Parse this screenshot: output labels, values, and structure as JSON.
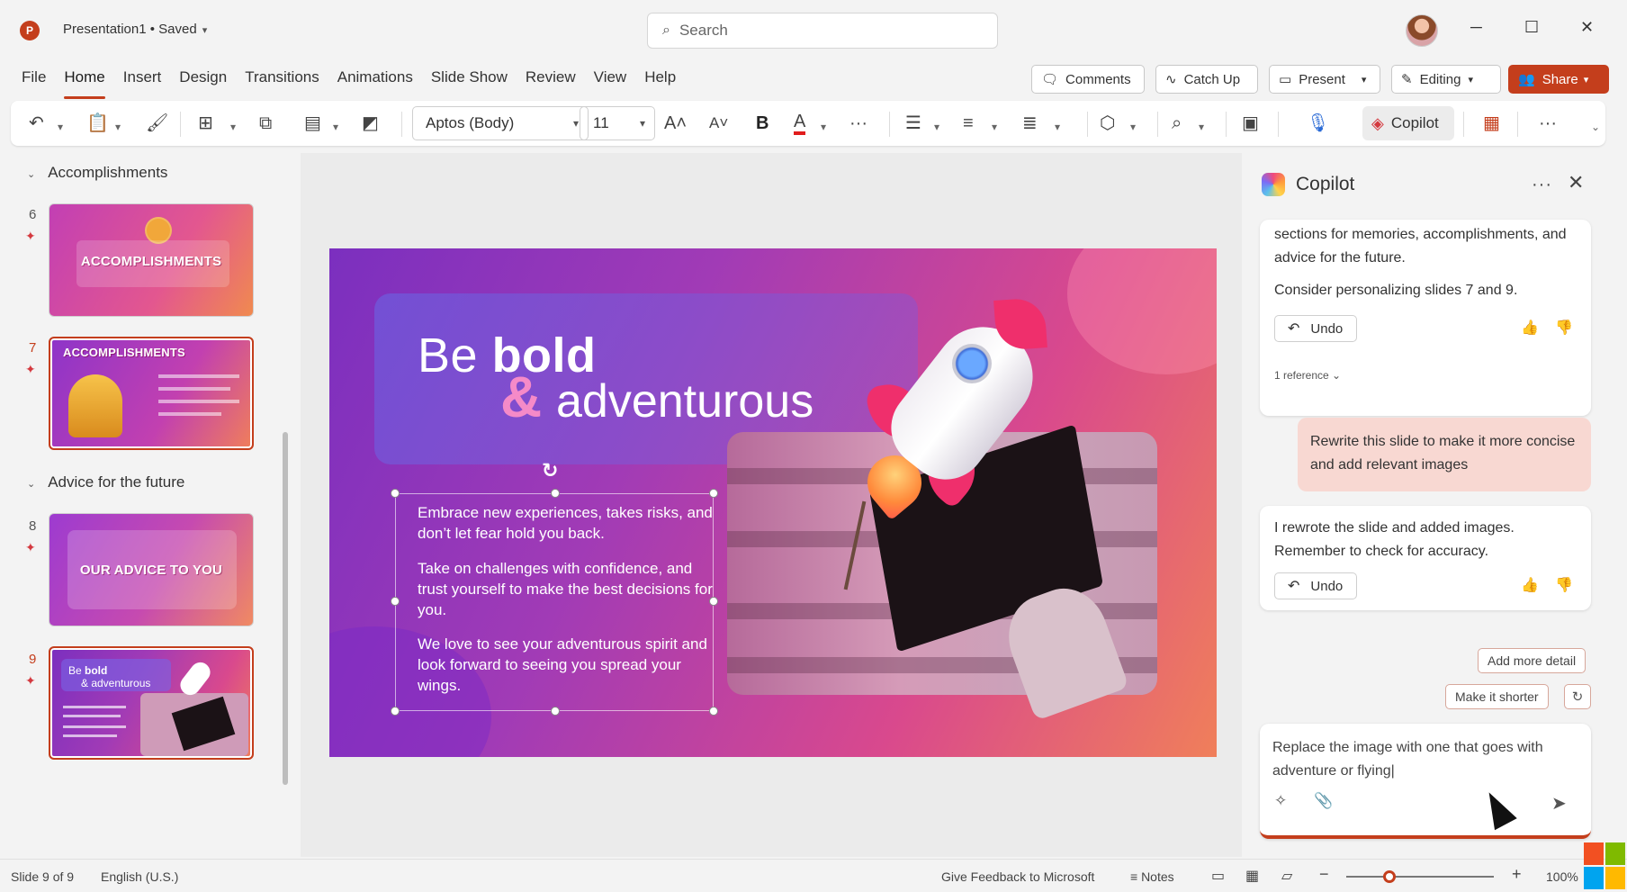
{
  "app": {
    "doc_title": "Presentation1 • Saved",
    "search_placeholder": "Search",
    "window_controls": [
      "─",
      "☐",
      "✕"
    ]
  },
  "ribbon": {
    "tabs": [
      "File",
      "Home",
      "Insert",
      "Design",
      "Transitions",
      "Animations",
      "Slide Show",
      "Review",
      "View",
      "Help"
    ],
    "active_tab": "Home",
    "comments": "Comments",
    "catch_up": "Catch Up",
    "present": "Present",
    "editing": "Editing",
    "share": "Share"
  },
  "toolbar": {
    "font_name": "Aptos (Body)",
    "font_size": "11",
    "bold": "B",
    "copilot": "Copilot"
  },
  "slides_panel": {
    "sections": [
      {
        "title": "Accomplishments"
      },
      {
        "title": "Advice for the future"
      }
    ],
    "thumbnails": [
      {
        "number": "6",
        "title": "ACCOMPLISHMENTS"
      },
      {
        "number": "7",
        "title": "ACCOMPLISHMENTS"
      },
      {
        "number": "8",
        "title": "OUR ADVICE TO YOU"
      },
      {
        "number": "9",
        "title_line1": "Be ",
        "title_bold": "bold",
        "title_line2": "& adventurous"
      }
    ]
  },
  "slide": {
    "title_prefix": "Be ",
    "title_bold": "bold",
    "amp": "&",
    "title_line2": "adventurous",
    "paragraphs": [
      "Embrace new experiences, takes risks, and don’t let fear hold you back.",
      "Take on challenges with confidence, and trust yourself to make the best decisions for you.",
      "We love to see your adventurous spirit and look forward to seeing you spread your wings."
    ]
  },
  "copilot": {
    "title": "Copilot",
    "msg1_line1": "sections for memories, accomplishments, and advice for the future.",
    "msg1_line2": "Consider personalizing slides 7 and 9.",
    "undo_label": "Undo",
    "reference_label": "1 reference",
    "user_msg": "Rewrite this slide to make it more concise and add relevant images",
    "msg2": "I rewrote the slide and added images. Remember to check for accuracy.",
    "chips": [
      "Add more detail",
      "Make it shorter"
    ],
    "composer_text": "Replace the image with one that goes with adventure or flying|"
  },
  "statusbar": {
    "slide_info": "Slide 9 of 9",
    "language": "English (U.S.)",
    "feedback": "Give Feedback to Microsoft",
    "notes": "Notes",
    "zoom": "100%"
  },
  "colors": {
    "accent": "#c43e1c",
    "slide_gradient_start": "#7b2fbf",
    "slide_gradient_end": "#f07f5a"
  }
}
